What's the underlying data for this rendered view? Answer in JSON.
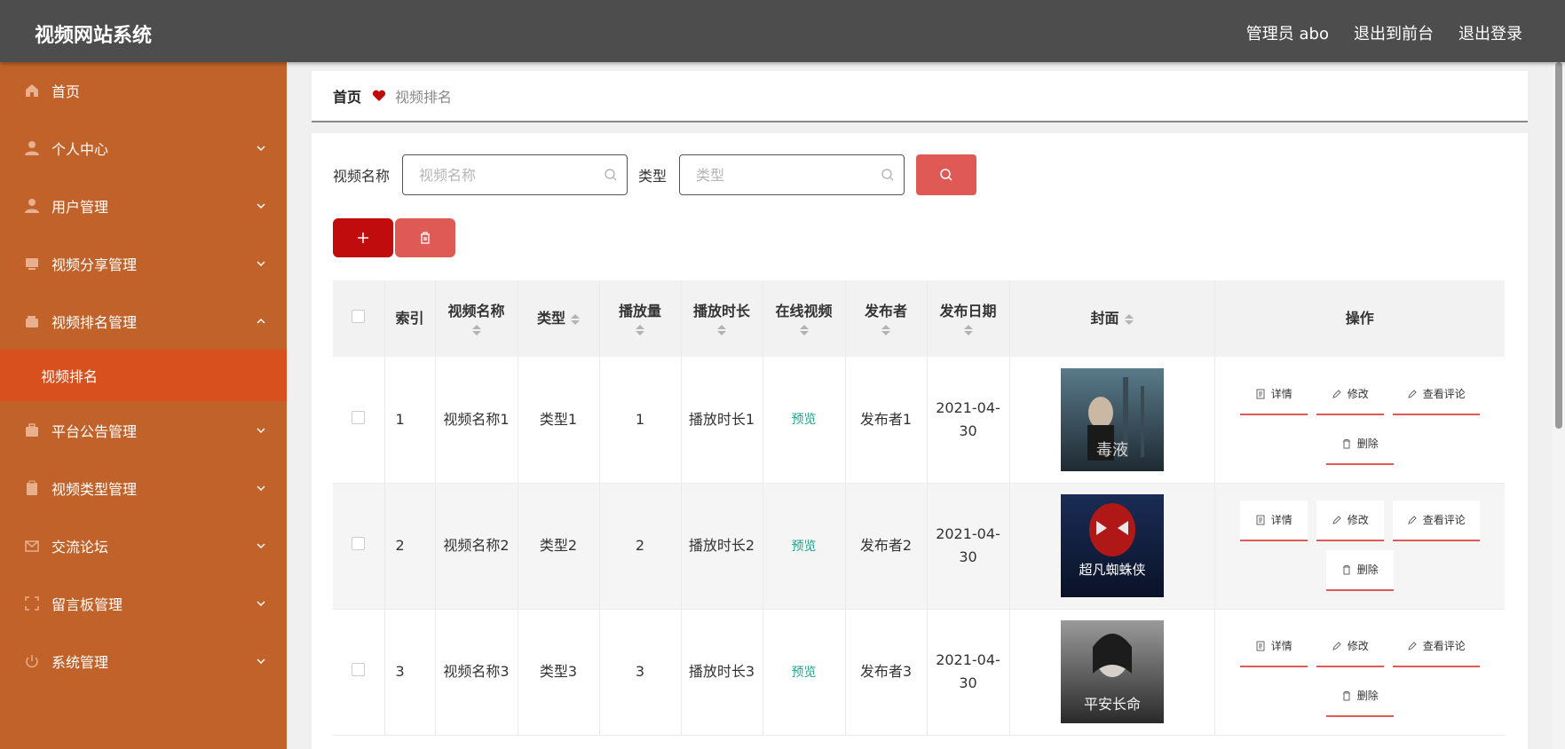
{
  "app": {
    "title": "视频网站系统"
  },
  "header": {
    "user": "管理员 abo",
    "front": "退出到前台",
    "logout": "退出登录"
  },
  "sidebar": {
    "items": [
      {
        "label": "首页",
        "icon": "home-icon"
      },
      {
        "label": "个人中心",
        "icon": "user-icon"
      },
      {
        "label": "用户管理",
        "icon": "user-icon"
      },
      {
        "label": "视频分享管理",
        "icon": "tv-icon"
      },
      {
        "label": "视频排名管理",
        "icon": "wallet-icon"
      },
      {
        "label": "平台公告管理",
        "icon": "briefcase-icon"
      },
      {
        "label": "视频类型管理",
        "icon": "clipboard-icon"
      },
      {
        "label": "交流论坛",
        "icon": "mail-icon"
      },
      {
        "label": "留言板管理",
        "icon": "frame-icon"
      },
      {
        "label": "系统管理",
        "icon": "power-icon"
      }
    ],
    "sub_active": "视频排名"
  },
  "breadcrumb": {
    "home": "首页",
    "current": "视频排名"
  },
  "search": {
    "name_label": "视频名称",
    "name_placeholder": "视频名称",
    "type_label": "类型",
    "type_placeholder": "类型"
  },
  "table": {
    "headers": [
      "索引",
      "视频名称",
      "类型",
      "播放量",
      "播放时长",
      "在线视频",
      "发布者",
      "发布日期",
      "封面",
      "操作"
    ],
    "rows": [
      {
        "index": "1",
        "name": "视频名称1",
        "type": "类型1",
        "plays": "1",
        "duration": "播放时长1",
        "online": "预览",
        "publisher": "发布者1",
        "date": "2021-04-30"
      },
      {
        "index": "2",
        "name": "视频名称2",
        "type": "类型2",
        "plays": "2",
        "duration": "播放时长2",
        "online": "预览",
        "publisher": "发布者2",
        "date": "2021-04-30"
      },
      {
        "index": "3",
        "name": "视频名称3",
        "type": "类型3",
        "plays": "3",
        "duration": "播放时长3",
        "online": "预览",
        "publisher": "发布者3",
        "date": "2021-04-30"
      }
    ],
    "ops": {
      "detail": "详情",
      "edit": "修改",
      "comments": "查看评论",
      "delete": "删除"
    },
    "covers": [
      "电影海报",
      "电影海报",
      "电影海报"
    ],
    "cover_texts": [
      "毒液",
      "超凡蜘蛛侠",
      "平安长命"
    ]
  },
  "colors": {
    "header": "#4d4d4d",
    "sidebar": "#c0622a",
    "sidebar_active": "#d8501e",
    "accent": "#e05a55",
    "add": "#c00c0c",
    "preview": "#1aa58a"
  }
}
